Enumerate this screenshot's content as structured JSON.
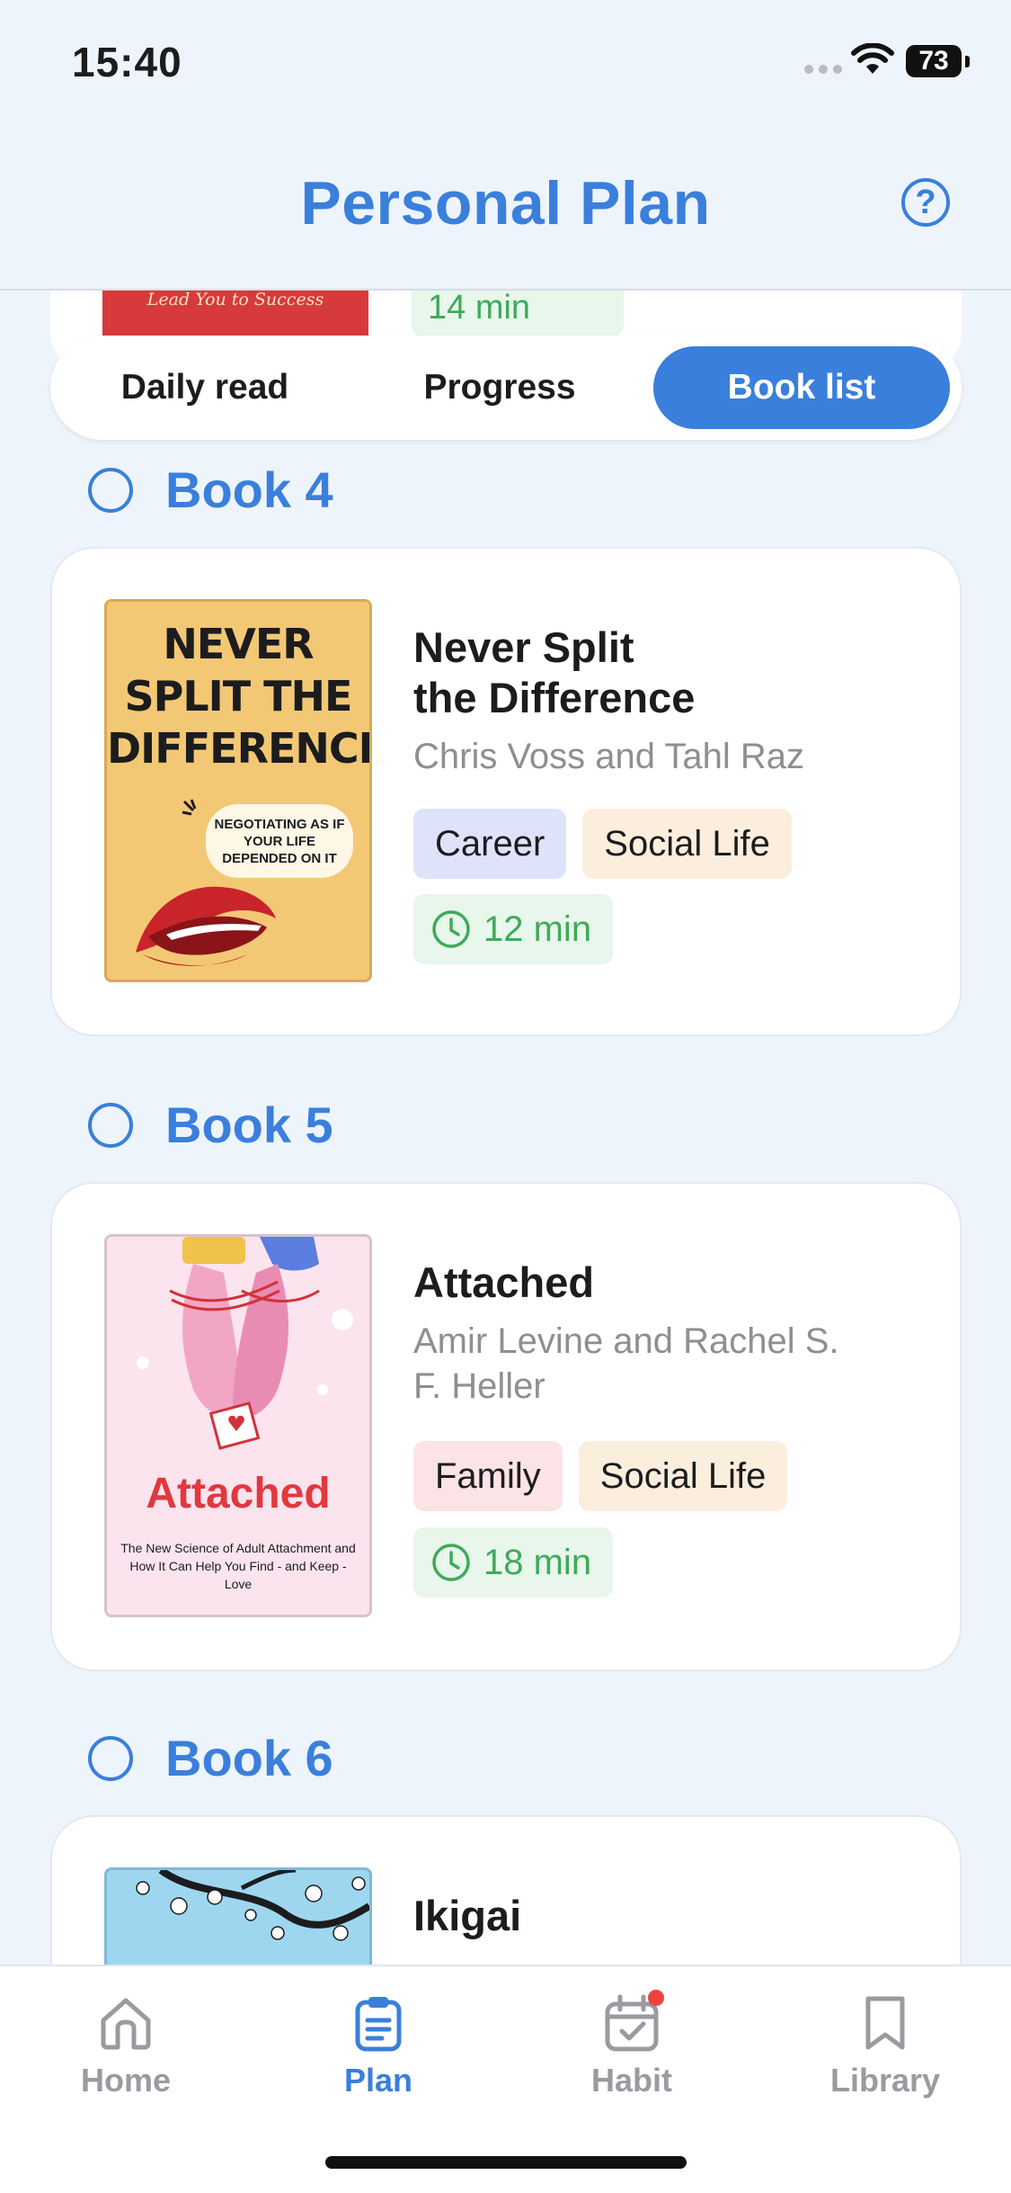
{
  "status_bar": {
    "time": "15:40",
    "battery": "73"
  },
  "header": {
    "title": "Personal Plan",
    "help_icon_text": "?"
  },
  "previous_book": {
    "cover_text": "The Only Book You Need to Lead You to Success",
    "duration": "14 min"
  },
  "segmented": {
    "tabs": [
      "Daily read",
      "Progress",
      "Book list"
    ],
    "active": "Book list"
  },
  "books": [
    {
      "label": "Book 4",
      "title_line1": "Never Split",
      "title_line2": "the Difference",
      "author": "Chris Voss and Tahl Raz",
      "tags": [
        "Career",
        "Social Life"
      ],
      "duration": "12 min",
      "cover": {
        "title": "NEVER SPLIT THE DIFFERENCE",
        "bubble": "NEGOTIATING AS IF YOUR LIFE DEPENDED ON IT"
      }
    },
    {
      "label": "Book 5",
      "title": "Attached",
      "author_line1": "Amir Levine and Rachel S.",
      "author_line2": "F. Heller",
      "tags": [
        "Family",
        "Social Life"
      ],
      "duration": "18 min",
      "cover": {
        "title": "Attached",
        "subtitle": "The New Science of Adult Attachment and How It Can Help You Find - and Keep - Love"
      }
    },
    {
      "label": "Book 6",
      "title": "Ikigai"
    }
  ],
  "tabbar": {
    "items": [
      "Home",
      "Plan",
      "Habit",
      "Library"
    ],
    "active": "Plan"
  },
  "colors": {
    "accent": "#3a7fdc",
    "green": "#3faa59",
    "notification": "#f0423c"
  }
}
